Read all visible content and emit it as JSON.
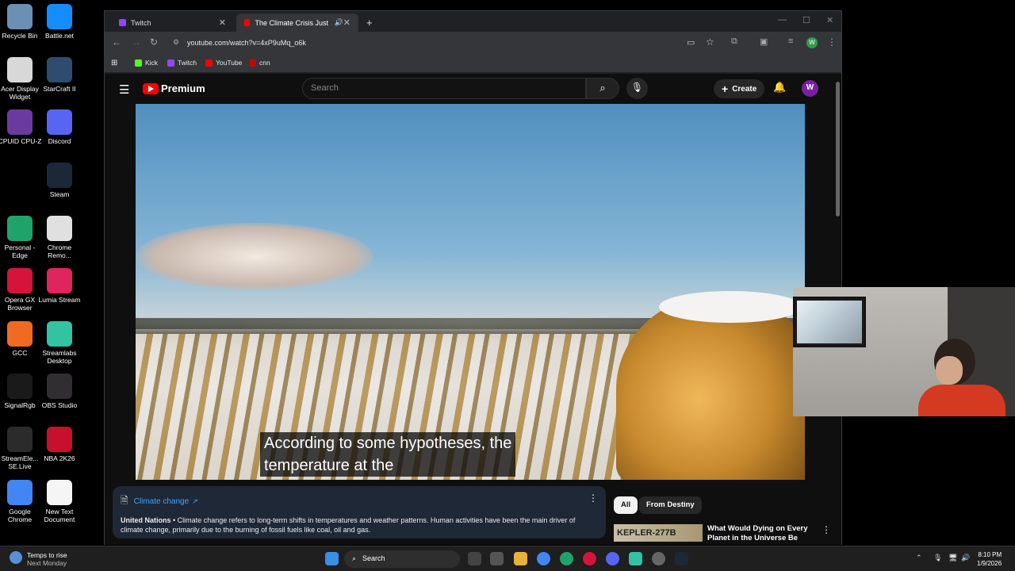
{
  "desktop": {
    "icons": [
      {
        "label": "Recycle Bin",
        "color": "#6b8fb5"
      },
      {
        "label": "Battle.net",
        "color": "#148eff"
      },
      {
        "label": "Acer Display Widget",
        "color": "#d8d8d8"
      },
      {
        "label": "StarCraft II",
        "color": "#2f4c6e"
      },
      {
        "label": "CPUID CPU-Z",
        "color": "#6a3aa0"
      },
      {
        "label": "Discord",
        "color": "#5865f2"
      },
      {
        "label": "Steam",
        "color": "#1b2838"
      },
      {
        "label": "Personal - Edge",
        "color": "#1fa36b"
      },
      {
        "label": "Chrome Remo...",
        "color": "#e0e0e0"
      },
      {
        "label": "Opera GX Browser",
        "color": "#d6133b"
      },
      {
        "label": "Lumia Stream",
        "color": "#e0245e"
      },
      {
        "label": "GCC",
        "color": "#f06a22"
      },
      {
        "label": "Streamlabs Desktop",
        "color": "#31c3a2"
      },
      {
        "label": "SignalRgb",
        "color": "#1a1a1a"
      },
      {
        "label": "OBS Studio",
        "color": "#302e31"
      },
      {
        "label": "StreamEle... SE.Live",
        "color": "#2b2b2b"
      },
      {
        "label": "NBA 2K26",
        "color": "#c8102e"
      },
      {
        "label": "Google Chrome",
        "color": "#4285f4"
      },
      {
        "label": "New Text Document",
        "color": "#f5f5f5"
      }
    ]
  },
  "browser": {
    "tabs": [
      {
        "title": "Twitch",
        "active": false
      },
      {
        "title": "The Climate Crisis Just Hit a",
        "active": true
      }
    ],
    "new_tab": "+",
    "url": "youtube.com/watch?v=4xP9uMq_o6k",
    "profile_initial": "W",
    "bookmarks": [
      {
        "label": "Kick",
        "color": "#53fc18"
      },
      {
        "label": "Twitch",
        "color": "#9146ff"
      },
      {
        "label": "YouTube",
        "color": "#ff0000"
      },
      {
        "label": "cnn",
        "color": "#cc0000"
      }
    ]
  },
  "youtube": {
    "brand": "Premium",
    "search_placeholder": "Search",
    "create_label": "Create",
    "avatar_initial": "W",
    "caption_line1": "According to some hypotheses, the",
    "caption_line2": "temperature at the",
    "info_panel": {
      "title": "Climate change",
      "source": "United Nations",
      "text": "• Climate change refers to long-term shifts in temperatures and weather patterns. Human activities have been the main driver of climate change, primarily due to the burning of fossil fuels like coal, oil and gas."
    },
    "chips": [
      "All",
      "From Destiny"
    ],
    "related": {
      "thumb_text": "KEPLER-277B",
      "title": "What Would Dying on Every Planet in the Universe Be Like?"
    }
  },
  "taskbar": {
    "weather_title": "Temps to rise",
    "weather_sub": "Next Monday",
    "search_label": "Search",
    "time": "8:10 PM",
    "date": "1/9/2026"
  }
}
